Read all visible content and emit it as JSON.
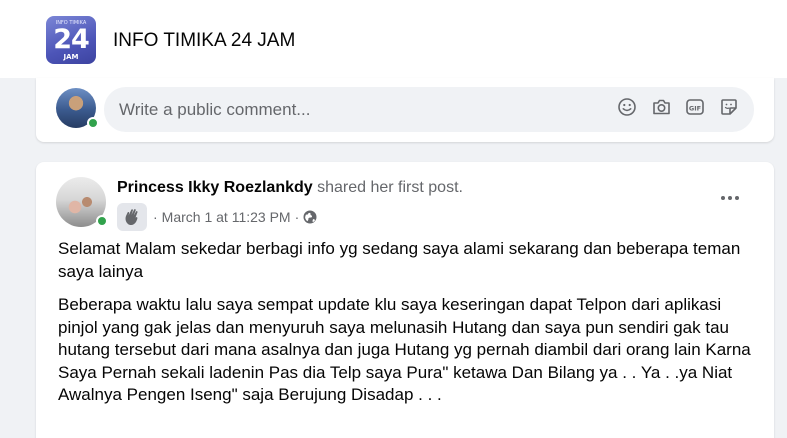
{
  "group": {
    "name": "INFO TIMIKA 24 JAM",
    "logo": {
      "top_text": "INFO TIMIKA",
      "number": "24",
      "bottom_text": "JAM"
    }
  },
  "comment_box": {
    "placeholder": "Write a public comment...",
    "icons": [
      "emoji-icon",
      "camera-icon",
      "gif-icon",
      "sticker-icon"
    ]
  },
  "post": {
    "author": "Princess Ikky Roezlankdy",
    "action": "shared her first post.",
    "separator": "·",
    "time": "March 1 at 11:23 PM",
    "audience_icon": "globe-icon",
    "badge_icon": "waving-hand-icon",
    "paragraphs": [
      "Selamat Malam sekedar berbagi info yg sedang saya alami sekarang dan beberapa teman saya lainya",
      "Beberapa waktu lalu saya sempat update klu saya keseringan dapat Telpon dari aplikasi pinjol yang gak jelas dan menyuruh saya melunasih Hutang dan saya pun sendiri gak tau hutang tersebut dari mana asalnya dan juga Hutang yg pernah diambil dari orang lain  Karna Saya Pernah sekali ladenin Pas dia Telp saya Pura\" ketawa Dan Bilang ya . . Ya . .ya Niat Awalnya Pengen Iseng\" saja Berujung Disadap . . ."
    ]
  },
  "colors": {
    "page_bg": "#f0f2f5",
    "card_bg": "#ffffff",
    "secondary_text": "#65676b",
    "online_green": "#31a24c",
    "logo_blue": "#4d55b8"
  }
}
